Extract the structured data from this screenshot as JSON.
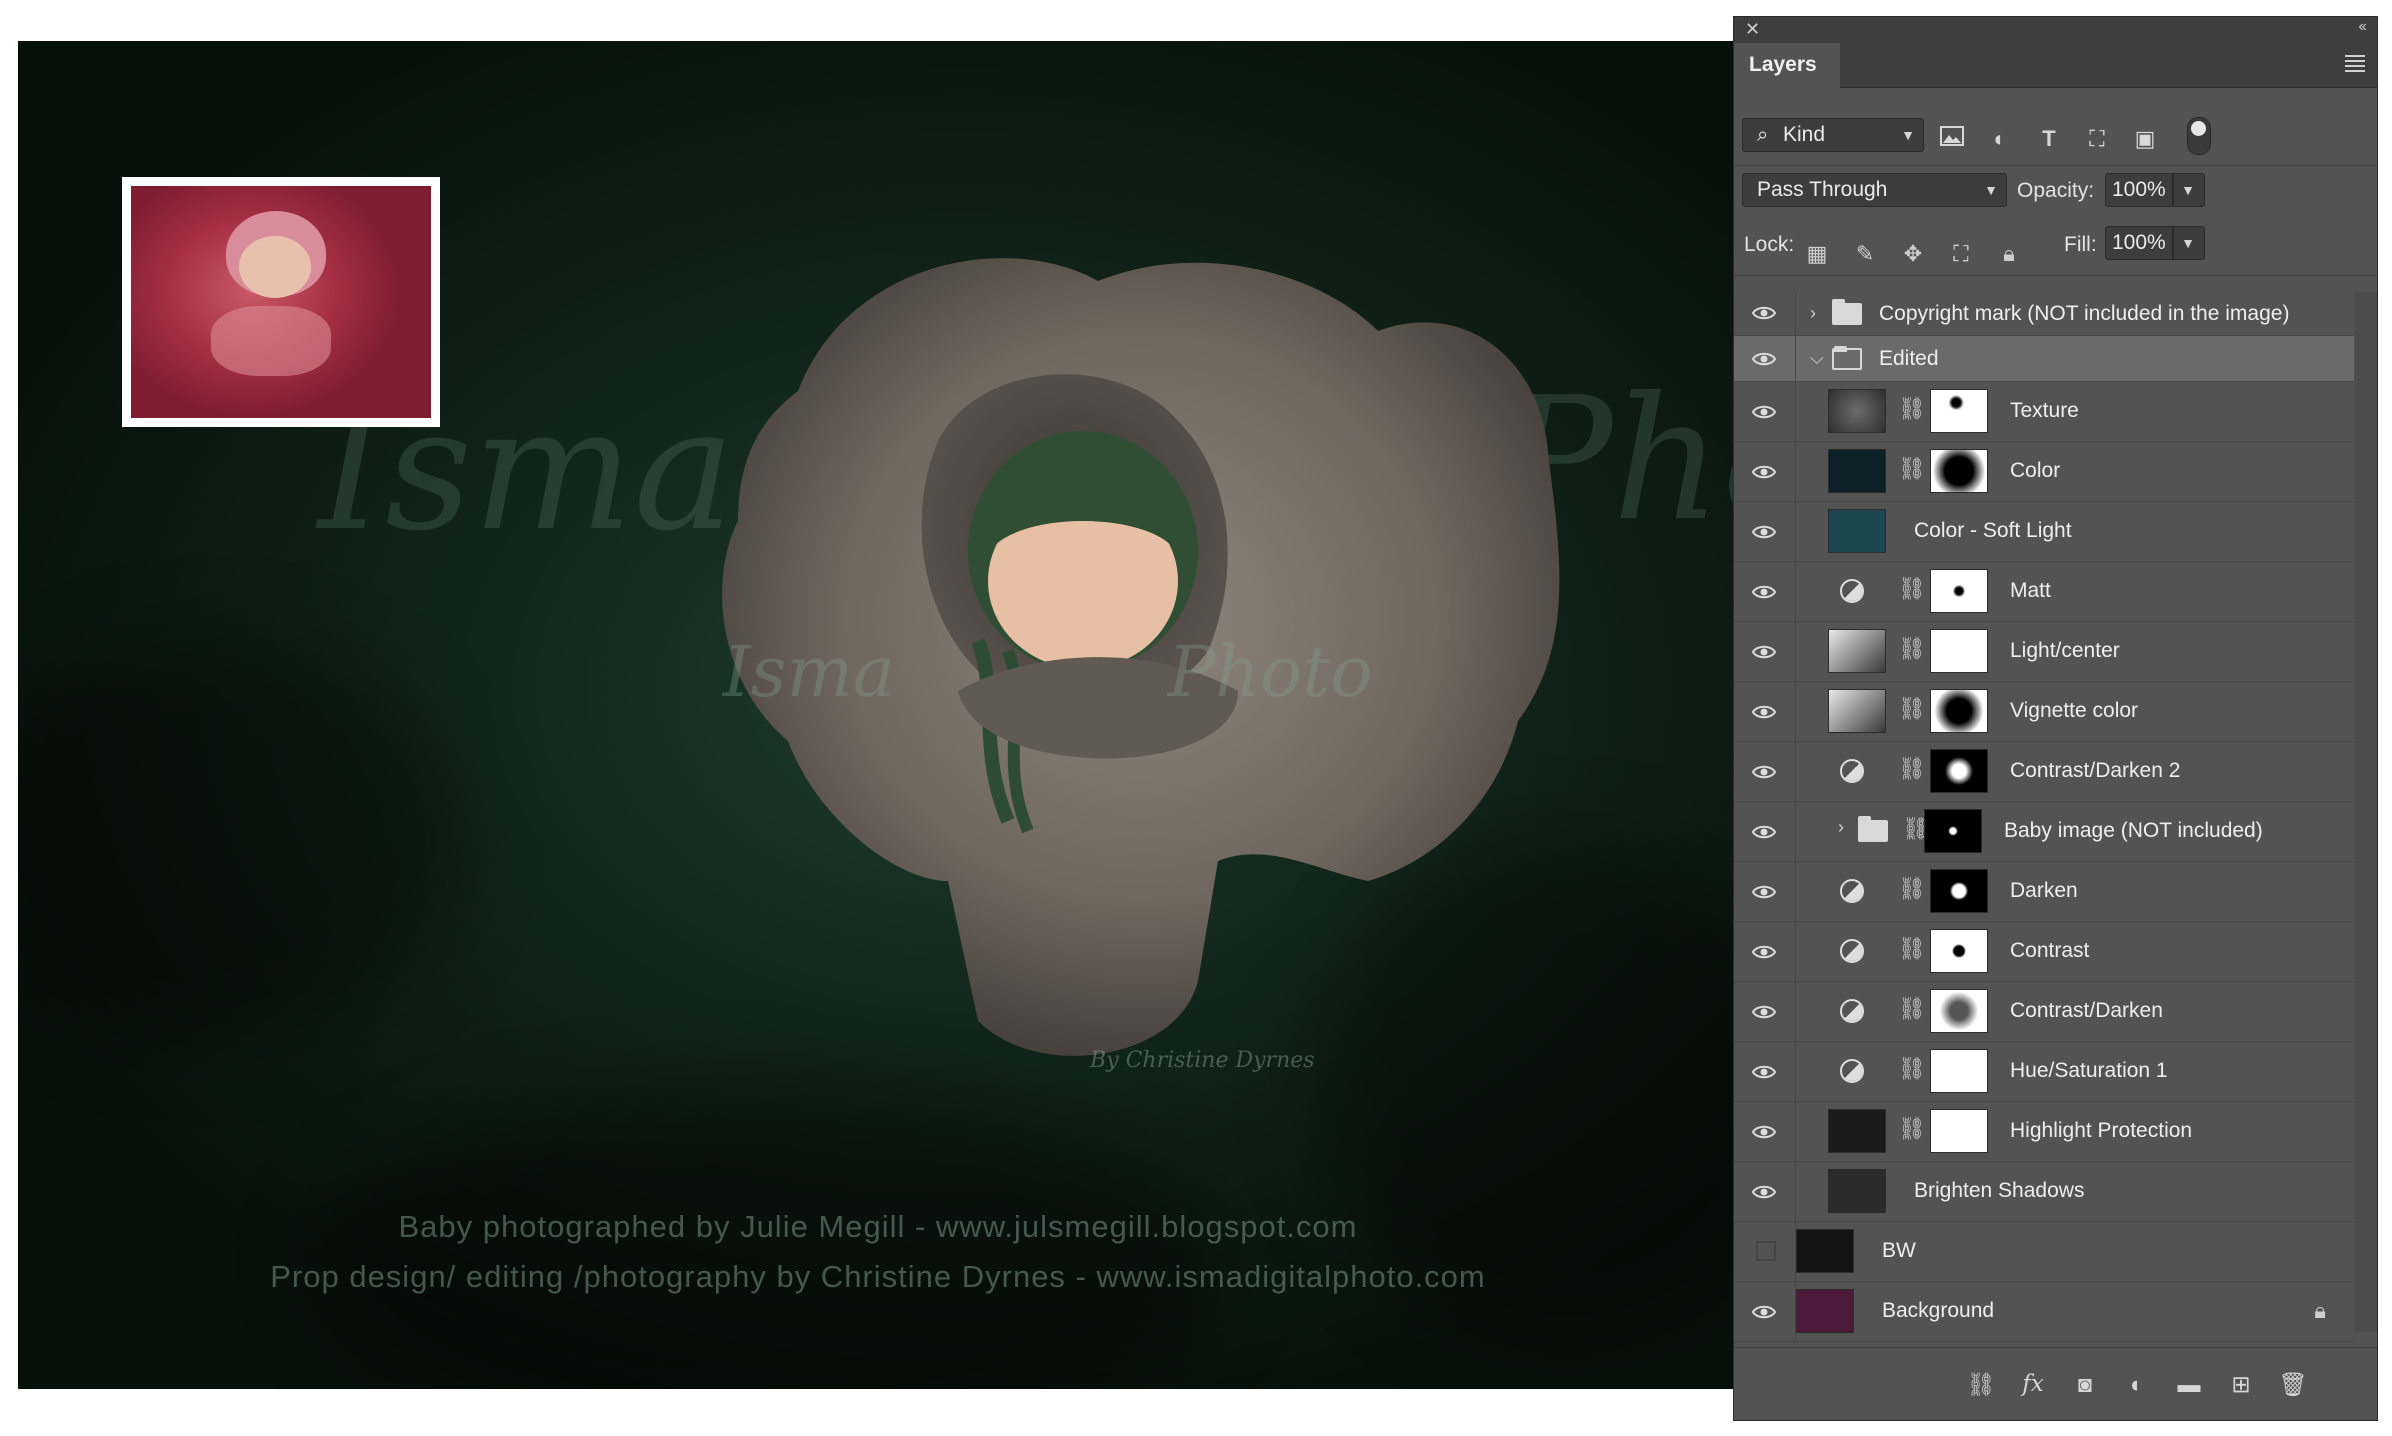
{
  "canvas": {
    "watermark_left": "Isma",
    "watermark_right": "Pho",
    "watermark_center_left": "Isma",
    "watermark_center_right": "Photo",
    "watermark_byline": "By Christine Dyrnes",
    "credit_line_1": "Baby photographed by Julie Megill - www.julsmegill.blogspot.com",
    "credit_line_2": "Prop design/ editing /photography by Christine Dyrnes - www.ismadigitalphoto.com"
  },
  "panel": {
    "tab_label": "Layers",
    "filter_kind": "Kind",
    "blend_mode": "Pass Through",
    "opacity_label": "Opacity:",
    "opacity_value": "100%",
    "lock_label": "Lock:",
    "fill_label": "Fill:",
    "fill_value": "100%"
  },
  "layers": [
    {
      "name": "Copyright mark (NOT included in the image)",
      "type": "group",
      "visible": true
    },
    {
      "name": "Edited",
      "type": "group-open",
      "visible": true,
      "selected": true
    },
    {
      "name": "Texture",
      "type": "pixel-mask",
      "visible": true
    },
    {
      "name": "Color",
      "type": "pixel-mask",
      "visible": true
    },
    {
      "name": "Color - Soft Light",
      "type": "fill",
      "visible": true
    },
    {
      "name": "Matt",
      "type": "adjustment",
      "visible": true
    },
    {
      "name": "Light/center",
      "type": "gradient-mask",
      "visible": true
    },
    {
      "name": "Vignette  color",
      "type": "gradient-mask",
      "visible": true
    },
    {
      "name": "Contrast/Darken 2",
      "type": "adjustment",
      "visible": true
    },
    {
      "name": "Baby image (NOT included)",
      "type": "group-mask",
      "visible": true
    },
    {
      "name": "Darken",
      "type": "adjustment",
      "visible": true
    },
    {
      "name": "Contrast",
      "type": "adjustment",
      "visible": true
    },
    {
      "name": "Contrast/Darken",
      "type": "adjustment",
      "visible": true
    },
    {
      "name": "Hue/Saturation 1",
      "type": "adjustment",
      "visible": true
    },
    {
      "name": "Highlight Protection",
      "type": "pixel-mask",
      "visible": true
    },
    {
      "name": "Brighten Shadows",
      "type": "pixel",
      "visible": true
    },
    {
      "name": "BW",
      "type": "pixel",
      "visible": false
    },
    {
      "name": "Background",
      "type": "background",
      "visible": true,
      "locked": true
    }
  ],
  "colors": {
    "panel_bg": "#535353",
    "selected_row": "#6a6a6a",
    "canvas_green": "#1e3f2e"
  },
  "icons": {
    "filter_icons": [
      "image-filter-icon",
      "adjustment-filter-icon",
      "type-filter-icon",
      "shape-filter-icon",
      "smart-object-filter-icon"
    ],
    "lock_icons": [
      "lock-transparent-icon",
      "lock-paint-icon",
      "lock-move-icon",
      "lock-artboard-icon",
      "lock-all-icon"
    ],
    "bottom_icons": [
      "link-layers-icon",
      "fx-icon",
      "add-mask-icon",
      "new-adjustment-icon",
      "new-group-icon",
      "new-layer-icon",
      "delete-layer-icon"
    ]
  }
}
